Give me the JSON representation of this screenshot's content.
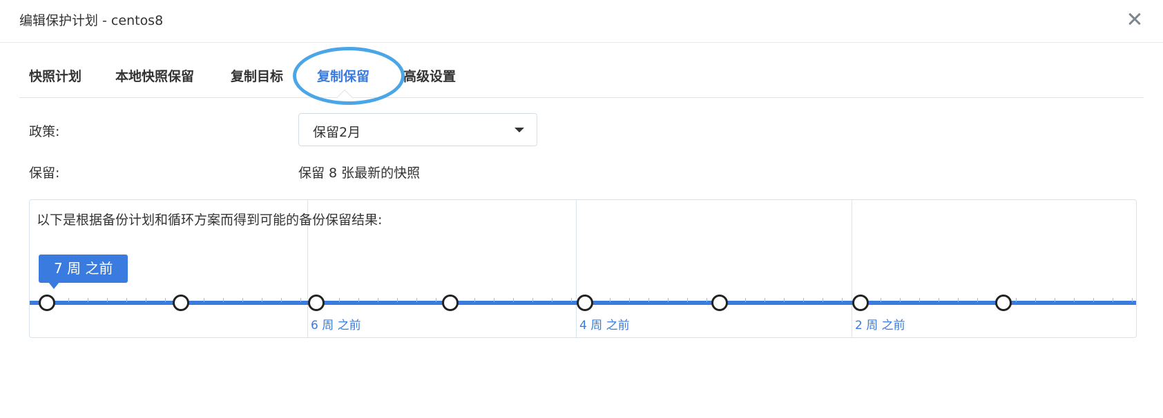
{
  "dialog": {
    "title": "编辑保护计划 - centos8",
    "close_icon": "close-icon"
  },
  "tabs": [
    {
      "label": "快照计划",
      "active": false
    },
    {
      "label": "本地快照保留",
      "active": false
    },
    {
      "label": "复制目标",
      "active": false
    },
    {
      "label": "复制保留",
      "active": true
    },
    {
      "label": "高级设置",
      "active": false
    }
  ],
  "policy": {
    "label": "政策:",
    "selected": "保留2月"
  },
  "retention": {
    "label": "保留:",
    "value": "保留 8 张最新的快照"
  },
  "timeline": {
    "caption": "以下是根据备份计划和循环方案而得到可能的备份保留结果:",
    "tooltip": "7 周 之前",
    "week_labels": [
      "6 周 之前",
      "4 周 之前",
      "2 周 之前"
    ],
    "snapshot_count": 8
  },
  "colors": {
    "accent": "#3a7be0",
    "highlight": "#4aa6e6",
    "text": "#333333"
  }
}
